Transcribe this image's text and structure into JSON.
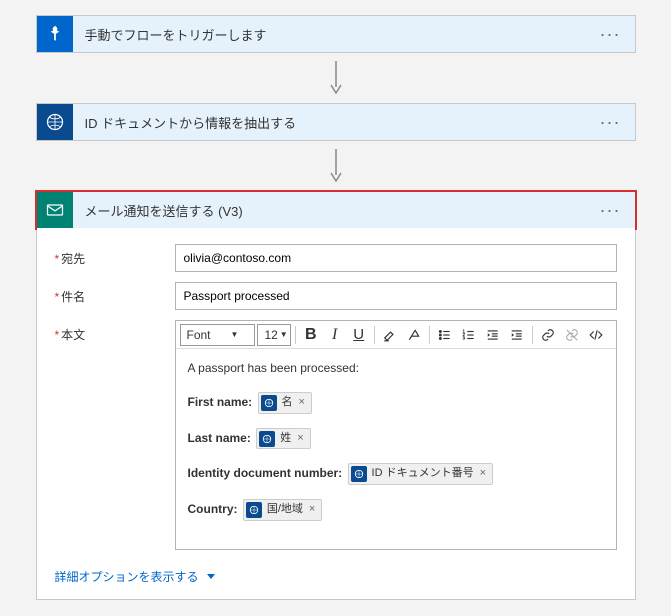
{
  "steps": {
    "trigger": {
      "title": "手動でフローをトリガーします"
    },
    "extract": {
      "title": "ID ドキュメントから情報を抽出する"
    },
    "mail": {
      "title": "メール通知を送信する (V3)"
    }
  },
  "form": {
    "toLabel": "宛先",
    "toValue": "olivia@contoso.com",
    "subjectLabel": "件名",
    "subjectValue": "Passport processed",
    "bodyLabel": "本文"
  },
  "toolbar": {
    "font": "Font",
    "size": "12"
  },
  "body": {
    "intro": "A passport has been processed:",
    "firstName": "First name:",
    "lastName": "Last name:",
    "docNum": "Identity document number:",
    "country": "Country:"
  },
  "tokens": {
    "firstName": "名",
    "lastName": "姓",
    "docNum": "ID ドキュメント番号",
    "country": "国/地域"
  },
  "advanced": "詳細オプションを表示する"
}
